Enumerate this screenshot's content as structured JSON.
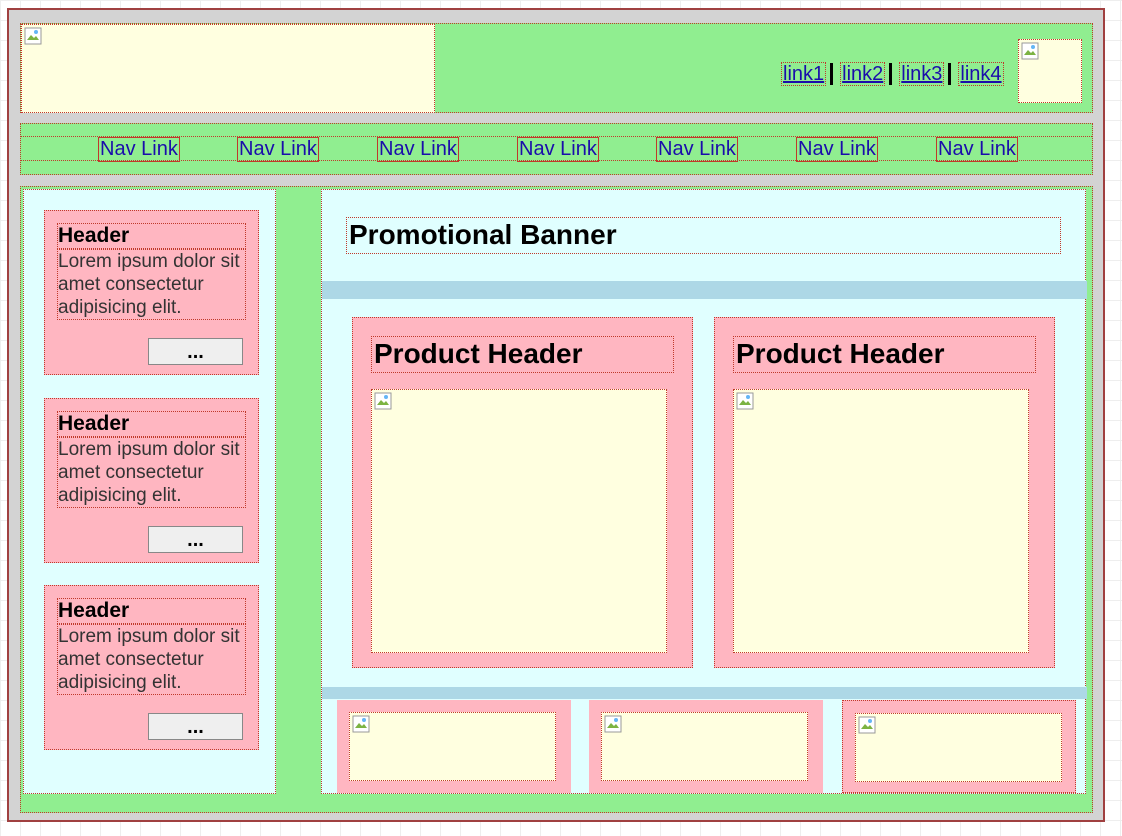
{
  "header": {
    "links": [
      "link1",
      "link2",
      "link3",
      "link4"
    ]
  },
  "nav": {
    "links": [
      "Nav Link",
      "Nav Link",
      "Nav Link",
      "Nav Link",
      "Nav Link",
      "Nav Link",
      "Nav Link"
    ]
  },
  "sidebar": {
    "cards": [
      {
        "header": "Header",
        "text": "Lorem ipsum dolor sit amet consectetur adipisicing elit.",
        "button": "..."
      },
      {
        "header": "Header",
        "text": "Lorem ipsum dolor sit amet consectetur adipisicing elit.",
        "button": "..."
      },
      {
        "header": "Header",
        "text": "Lorem ipsum dolor sit amet consectetur adipisicing elit.",
        "button": "..."
      }
    ]
  },
  "main": {
    "promo_title": "Promotional Banner",
    "products": [
      {
        "header": "Product Header"
      },
      {
        "header": "Product Header"
      }
    ]
  },
  "icons": {
    "broken_image": "broken-image-icon"
  },
  "colors": {
    "header_bg": "#90ee90",
    "logo_bg": "#ffffe0",
    "sidebar_bg": "#e0ffff",
    "card_bg": "#ffb6c1",
    "bar_bg": "#add8e6",
    "page_bg": "#d3d3d3",
    "outline": "#c0392b"
  }
}
